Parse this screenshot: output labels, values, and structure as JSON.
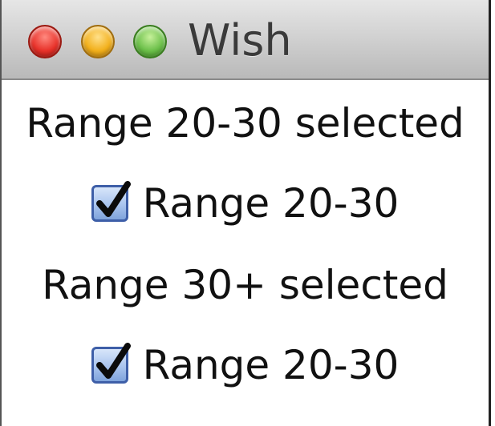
{
  "window": {
    "title": "Wish"
  },
  "content": {
    "status_1": "Range 20-30 selected",
    "checkbox_1_label": "Range 20-30",
    "checkbox_1_checked": true,
    "status_2": "Range 30+ selected",
    "checkbox_2_label": "Range 20-30",
    "checkbox_2_checked": true
  },
  "colors": {
    "close_button": "#e8322a",
    "minimize_button": "#f2b01c",
    "zoom_button": "#6cc04a",
    "checkbox_fill": "#a9c4ee",
    "checkmark": "#0b0b0b"
  },
  "icons": {
    "checkmark": "check-icon"
  }
}
